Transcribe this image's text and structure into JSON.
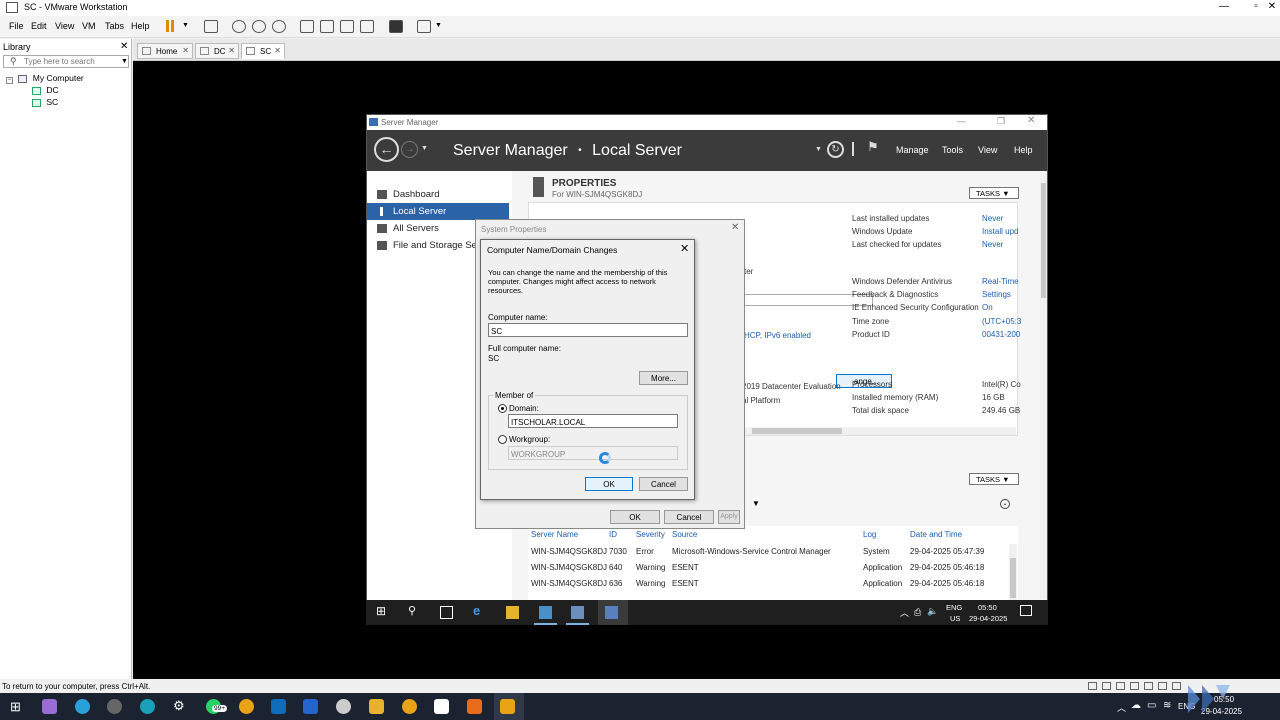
{
  "vmware": {
    "title": "SC - VMware Workstation",
    "menu": [
      "File",
      "Edit",
      "View",
      "VM",
      "Tabs",
      "Help"
    ],
    "library": {
      "header": "Library",
      "search_placeholder": "Type here to search",
      "root": "My Computer",
      "vms": [
        "DC",
        "SC"
      ]
    },
    "tabs": [
      "Home",
      "DC",
      "SC"
    ],
    "status_text": "To return to your computer, press Ctrl+Alt."
  },
  "server_manager": {
    "window_title": "Server Manager",
    "breadcrumb_root": "Server Manager",
    "breadcrumb_sep": "•",
    "breadcrumb_page": "Local Server",
    "menu": [
      "Manage",
      "Tools",
      "View",
      "Help"
    ],
    "nav": [
      "Dashboard",
      "Local Server",
      "All Servers",
      "File and Storage Ser"
    ],
    "properties_title": "PROPERTIES",
    "properties_sub": "For WIN-SJM4QSGK8DJ",
    "tasks_label": "TASKS ▼",
    "partial_text": {
      "computer": "computer",
      "dhcp": "HCP, IPv6 enabled",
      "change": "ange...",
      "evaluation": "2019 Datacenter Evaluation",
      "platform": "al Platform"
    },
    "right_props": [
      {
        "label": "Last installed updates",
        "value": "Never"
      },
      {
        "label": "Windows Update",
        "value": "Install upd"
      },
      {
        "label": "Last checked for updates",
        "value": "Never"
      },
      {
        "label": "Windows Defender Antivirus",
        "value": "Real-Time"
      },
      {
        "label": "Feedback & Diagnostics",
        "value": "Settings"
      },
      {
        "label": "IE Enhanced Security Configuration",
        "value": "On"
      },
      {
        "label": "Time zone",
        "value": "(UTC+05:3"
      },
      {
        "label": "Product ID",
        "value": "00431-200"
      },
      {
        "label": "Processors",
        "value": "Intel(R) Co"
      },
      {
        "label": "Installed memory (RAM)",
        "value": "16 GB"
      },
      {
        "label": "Total disk space",
        "value": "249.46 GB"
      }
    ],
    "events_headers": [
      "Server Name",
      "ID",
      "Severity",
      "Source",
      "Log",
      "Date and Time"
    ],
    "events": [
      {
        "server": "WIN-SJM4QSGK8DJ",
        "id": "7030",
        "severity": "Error",
        "source": "Microsoft-Windows-Service Control Manager",
        "log": "System",
        "date": "29-04-2025 05:47:39"
      },
      {
        "server": "WIN-SJM4QSGK8DJ",
        "id": "640",
        "severity": "Warning",
        "source": "ESENT",
        "log": "Application",
        "date": "29-04-2025 05:46:18"
      },
      {
        "server": "WIN-SJM4QSGK8DJ",
        "id": "636",
        "severity": "Warning",
        "source": "ESENT",
        "log": "Application",
        "date": "29-04-2025 05:46:18"
      }
    ]
  },
  "system_properties": {
    "title": "System Properties",
    "ok": "OK",
    "cancel": "Cancel",
    "apply": "Apply"
  },
  "dialog": {
    "title": "Computer Name/Domain Changes",
    "description": "You can change the name and the membership of this computer. Changes might affect access to network resources.",
    "computer_name_label": "Computer name:",
    "computer_name_value": "SC",
    "full_name_label": "Full computer name:",
    "full_name_value": "SC",
    "more_button": "More...",
    "member_of": "Member of",
    "domain_label": "Domain:",
    "domain_value": "ITSCHOLAR.LOCAL",
    "workgroup_label": "Workgroup:",
    "workgroup_value": "WORKGROUP",
    "ok": "OK",
    "cancel": "Cancel"
  },
  "guest_tray": {
    "lang": "ENG",
    "region": "US",
    "time": "05:50",
    "date": "29-04-2025"
  },
  "host_tray": {
    "badge": "99+",
    "lang": "ENG",
    "time": "05:50",
    "date": "29-04-2025"
  },
  "colors": {
    "accent": "#2b63a8",
    "sm_header": "#3b3b3b",
    "link": "#1a5fb4"
  }
}
